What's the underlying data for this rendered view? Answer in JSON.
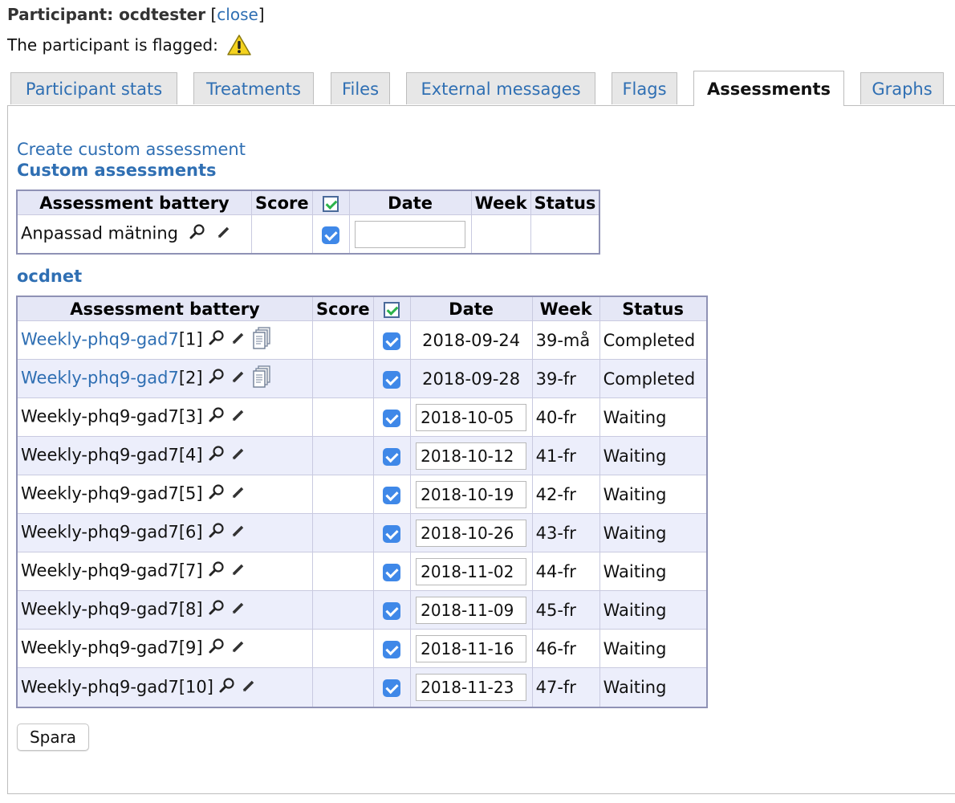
{
  "header": {
    "participant_label": "Participant: ocdtester",
    "close_open": "[",
    "close_label": "close",
    "close_close": "]",
    "flagged_text": "The participant is flagged:"
  },
  "tabs": [
    {
      "label": "Participant stats"
    },
    {
      "label": "Treatments"
    },
    {
      "label": "Files"
    },
    {
      "label": "External messages"
    },
    {
      "label": "Flags"
    },
    {
      "label": "Assessments",
      "active": true
    },
    {
      "label": "Graphs"
    }
  ],
  "create_link": "Create custom assessment",
  "custom": {
    "title": "Custom assessments",
    "headers": [
      "Assessment battery",
      "Score",
      "",
      "Date",
      "Week",
      "Status"
    ],
    "rows": [
      {
        "name": "Anpassad mätning",
        "score": "",
        "checked": true,
        "date": "",
        "week": "",
        "status": ""
      }
    ]
  },
  "ocdnet": {
    "title": "ocdnet",
    "headers": [
      "Assessment battery",
      "Score",
      "",
      "Date",
      "Week",
      "Status"
    ],
    "rows": [
      {
        "name": "Weekly-phq9-gad7",
        "suffix": "[1]",
        "linked": true,
        "score": "",
        "date": "2018-09-24",
        "editable": false,
        "week": "39-må",
        "status": "Completed"
      },
      {
        "name": "Weekly-phq9-gad7",
        "suffix": "[2]",
        "linked": true,
        "score": "",
        "date": "2018-09-28",
        "editable": false,
        "week": "39-fr",
        "status": "Completed"
      },
      {
        "name": "Weekly-phq9-gad7",
        "suffix": "[3]",
        "linked": false,
        "score": "",
        "date": "2018-10-05",
        "editable": true,
        "week": "40-fr",
        "status": "Waiting"
      },
      {
        "name": "Weekly-phq9-gad7",
        "suffix": "[4]",
        "linked": false,
        "score": "",
        "date": "2018-10-12",
        "editable": true,
        "week": "41-fr",
        "status": "Waiting"
      },
      {
        "name": "Weekly-phq9-gad7",
        "suffix": "[5]",
        "linked": false,
        "score": "",
        "date": "2018-10-19",
        "editable": true,
        "week": "42-fr",
        "status": "Waiting"
      },
      {
        "name": "Weekly-phq9-gad7",
        "suffix": "[6]",
        "linked": false,
        "score": "",
        "date": "2018-10-26",
        "editable": true,
        "week": "43-fr",
        "status": "Waiting"
      },
      {
        "name": "Weekly-phq9-gad7",
        "suffix": "[7]",
        "linked": false,
        "score": "",
        "date": "2018-11-02",
        "editable": true,
        "week": "44-fr",
        "status": "Waiting"
      },
      {
        "name": "Weekly-phq9-gad7",
        "suffix": "[8]",
        "linked": false,
        "score": "",
        "date": "2018-11-09",
        "editable": true,
        "week": "45-fr",
        "status": "Waiting"
      },
      {
        "name": "Weekly-phq9-gad7",
        "suffix": "[9]",
        "linked": false,
        "score": "",
        "date": "2018-11-16",
        "editable": true,
        "week": "46-fr",
        "status": "Waiting"
      },
      {
        "name": "Weekly-phq9-gad7",
        "suffix": "[10]",
        "linked": false,
        "score": "",
        "date": "2018-11-23",
        "editable": true,
        "week": "47-fr",
        "status": "Waiting"
      }
    ]
  },
  "save_label": "Spara",
  "colors": {
    "link": "#2f6fb3",
    "header_bg": "#e5e7f6",
    "row_alt": "#eceefb",
    "check": "#3f88e8",
    "border": "#8f92b5"
  }
}
